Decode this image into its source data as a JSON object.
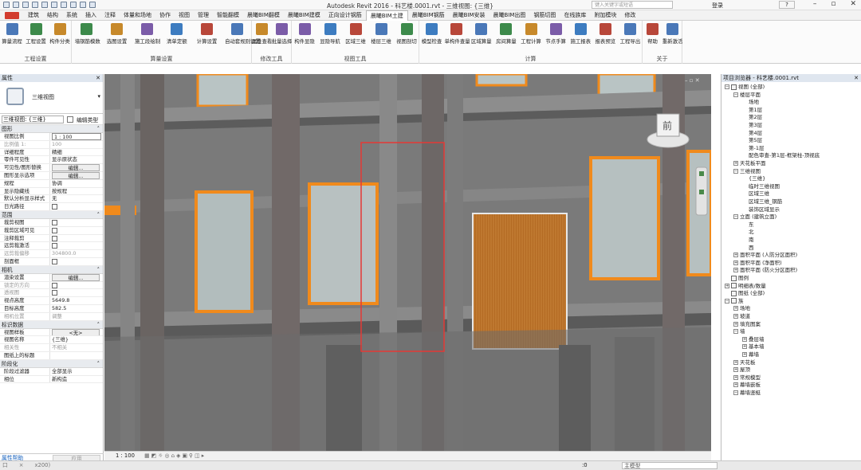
{
  "titlebar": {
    "title": "Autodesk Revit 2016 -      科艺楼.0001.rvt - 三维视图: {三维}",
    "search_placeholder": "键入关键字或短语",
    "login": "登录",
    "help": "?"
  },
  "tabs": [
    "建筑",
    "结构",
    "系统",
    "插入",
    "注释",
    "体量和场地",
    "协作",
    "视图",
    "管理",
    "智能翻模",
    "晨曦BIM翻模",
    "晨曦BIM建模",
    "正向设计钢筋",
    "晨曦BIM土建",
    "晨曦BIM钢筋",
    "晨曦BIM安装",
    "晨曦BIM出图",
    "钢筋切图",
    "在线族库",
    "附加模块",
    "修改"
  ],
  "active_tab": "晨曦BIM土建",
  "ribbon": {
    "groups": [
      {
        "label": "工程设置",
        "buttons": [
          "算量流程",
          "工程设置",
          "构件分类"
        ]
      },
      {
        "label": "算量设置",
        "buttons": [
          "墙钢筋模数",
          "选图设置",
          "施工段绘制",
          "清单定额",
          "计算设置",
          "自动套规则设置"
        ]
      },
      {
        "label": "修改工具",
        "buttons": [
          "属性查看",
          "批量选择"
        ]
      },
      {
        "label": "视图工具",
        "buttons": [
          "构件显隐",
          "显隐导航",
          "区域三维",
          "楼层三维",
          "视图剖切"
        ]
      },
      {
        "label": "计算",
        "buttons": [
          "模型检查",
          "单构件查量",
          "区域算量",
          "房间算量",
          "工程计算",
          "节点手算",
          "施工报表",
          "报表预览",
          "工程导出"
        ]
      },
      {
        "label": "关于",
        "buttons": [
          "帮助",
          "重新激活"
        ]
      }
    ]
  },
  "properties": {
    "header": "属性",
    "type_name": "三维视图",
    "instance_select": "三维视图: {三维}",
    "edit_type": "编辑类型",
    "sections": [
      {
        "name": "图形",
        "rows": [
          {
            "k": "视图比例",
            "v": "1 : 100",
            "kind": "field"
          },
          {
            "k": "比例值 1:",
            "v": "100",
            "kind": "dim"
          },
          {
            "k": "详细程度",
            "v": "精细",
            "kind": "text"
          },
          {
            "k": "零件可见性",
            "v": "显示原状态",
            "kind": "text"
          },
          {
            "k": "可见性/图形替换",
            "v": "编辑...",
            "kind": "button"
          },
          {
            "k": "图形显示选项",
            "v": "编辑...",
            "kind": "button"
          },
          {
            "k": "规程",
            "v": "协调",
            "kind": "text"
          },
          {
            "k": "显示隐藏线",
            "v": "按规程",
            "kind": "text"
          },
          {
            "k": "默认分析显示样式",
            "v": "无",
            "kind": "text"
          },
          {
            "k": "日光路径",
            "v": "",
            "kind": "check"
          }
        ]
      },
      {
        "name": "范围",
        "rows": [
          {
            "k": "裁剪视图",
            "v": "",
            "kind": "check"
          },
          {
            "k": "裁剪区域可见",
            "v": "",
            "kind": "check"
          },
          {
            "k": "注释裁剪",
            "v": "",
            "kind": "check"
          },
          {
            "k": "远剪裁激活",
            "v": "",
            "kind": "check"
          },
          {
            "k": "远剪裁偏移",
            "v": "304800.0",
            "kind": "dim"
          },
          {
            "k": "剖面框",
            "v": "",
            "kind": "check"
          }
        ]
      },
      {
        "name": "相机",
        "rows": [
          {
            "k": "渲染设置",
            "v": "编辑...",
            "kind": "button"
          },
          {
            "k": "锁定的方向",
            "v": "",
            "kind": "dimcheck"
          },
          {
            "k": "透视图",
            "v": "",
            "kind": "dimcheck"
          },
          {
            "k": "视点高度",
            "v": "5649.8",
            "kind": "text"
          },
          {
            "k": "目标高度",
            "v": "582.5",
            "kind": "text"
          },
          {
            "k": "相机位置",
            "v": "调整",
            "kind": "dim"
          }
        ]
      },
      {
        "name": "标识数据",
        "rows": [
          {
            "k": "视图样板",
            "v": "<无>",
            "kind": "button"
          },
          {
            "k": "视图名称",
            "v": "{三维}",
            "kind": "text"
          },
          {
            "k": "相关性",
            "v": "不相关",
            "kind": "dim"
          },
          {
            "k": "图纸上的标题",
            "v": "",
            "kind": "text"
          }
        ]
      },
      {
        "name": "阶段化",
        "rows": [
          {
            "k": "阶段过滤器",
            "v": "全部显示",
            "kind": "text"
          },
          {
            "k": "相位",
            "v": "新构造",
            "kind": "text"
          }
        ]
      }
    ],
    "help_link": "属性帮助",
    "apply": "应用"
  },
  "viewport": {
    "viewcube_label": "前",
    "scale": "1 : 100"
  },
  "browser": {
    "header": "项目浏览器 - 科艺楼.0001.rvt",
    "nodes": [
      {
        "t": "视图 (全部)",
        "l": 0,
        "tg": "-",
        "ic": true
      },
      {
        "t": "楼层平面",
        "l": 1,
        "tg": "-"
      },
      {
        "t": "场地",
        "l": 2
      },
      {
        "t": "第1层",
        "l": 2
      },
      {
        "t": "第2层",
        "l": 2
      },
      {
        "t": "第3层",
        "l": 2
      },
      {
        "t": "第4层",
        "l": 2
      },
      {
        "t": "第5层",
        "l": 2
      },
      {
        "t": "第-1层",
        "l": 2
      },
      {
        "t": "配色审查-第1层-框架柱-顶视底",
        "l": 2
      },
      {
        "t": "天花板平面",
        "l": 1,
        "tg": "+"
      },
      {
        "t": "三维视图",
        "l": 1,
        "tg": "-"
      },
      {
        "t": "{三维}",
        "l": 2
      },
      {
        "t": "临时三维视图",
        "l": 2
      },
      {
        "t": "区域三维",
        "l": 2
      },
      {
        "t": "区域三维_钢筋",
        "l": 2
      },
      {
        "t": "装饰区域显示",
        "l": 2
      },
      {
        "t": "立面 (建筑立面)",
        "l": 1,
        "tg": "-"
      },
      {
        "t": "东",
        "l": 2
      },
      {
        "t": "北",
        "l": 2
      },
      {
        "t": "南",
        "l": 2
      },
      {
        "t": "西",
        "l": 2
      },
      {
        "t": "面积平面 (人防分区面积)",
        "l": 1,
        "tg": "+"
      },
      {
        "t": "面积平面 (净面积)",
        "l": 1,
        "tg": "+"
      },
      {
        "t": "面积平面 (防火分区面积)",
        "l": 1,
        "tg": "+"
      },
      {
        "t": "图例",
        "l": 0,
        "ic": true
      },
      {
        "t": "明细表/数量",
        "l": 0,
        "tg": "+",
        "ic": true
      },
      {
        "t": "图纸 (全部)",
        "l": 0,
        "ic": true
      },
      {
        "t": "族",
        "l": 0,
        "tg": "-",
        "ic": true
      },
      {
        "t": "场地",
        "l": 1,
        "tg": "+"
      },
      {
        "t": "坡道",
        "l": 1,
        "tg": "+"
      },
      {
        "t": "填充图案",
        "l": 1,
        "tg": "+"
      },
      {
        "t": "墙",
        "l": 1,
        "tg": "-"
      },
      {
        "t": "叠层墙",
        "l": 2,
        "tg": "+"
      },
      {
        "t": "基本墙",
        "l": 2,
        "tg": "+"
      },
      {
        "t": "幕墙",
        "l": 2,
        "tg": "+"
      },
      {
        "t": "天花板",
        "l": 1,
        "tg": "+"
      },
      {
        "t": "屋顶",
        "l": 1,
        "tg": "+"
      },
      {
        "t": "常规模型",
        "l": 1,
        "tg": "+"
      },
      {
        "t": "幕墙嵌板",
        "l": 1,
        "tg": "+"
      },
      {
        "t": "幕墙竖梃",
        "l": 1,
        "tg": "-"
      }
    ]
  },
  "status": {
    "left_items": [
      "口",
      "×"
    ],
    "zoom": "x200)",
    "worksets": ":0",
    "model": "主模型"
  },
  "colors": {
    "accent": "#f08a1c",
    "wood": "#c07a2a",
    "selection": "#e53935"
  }
}
